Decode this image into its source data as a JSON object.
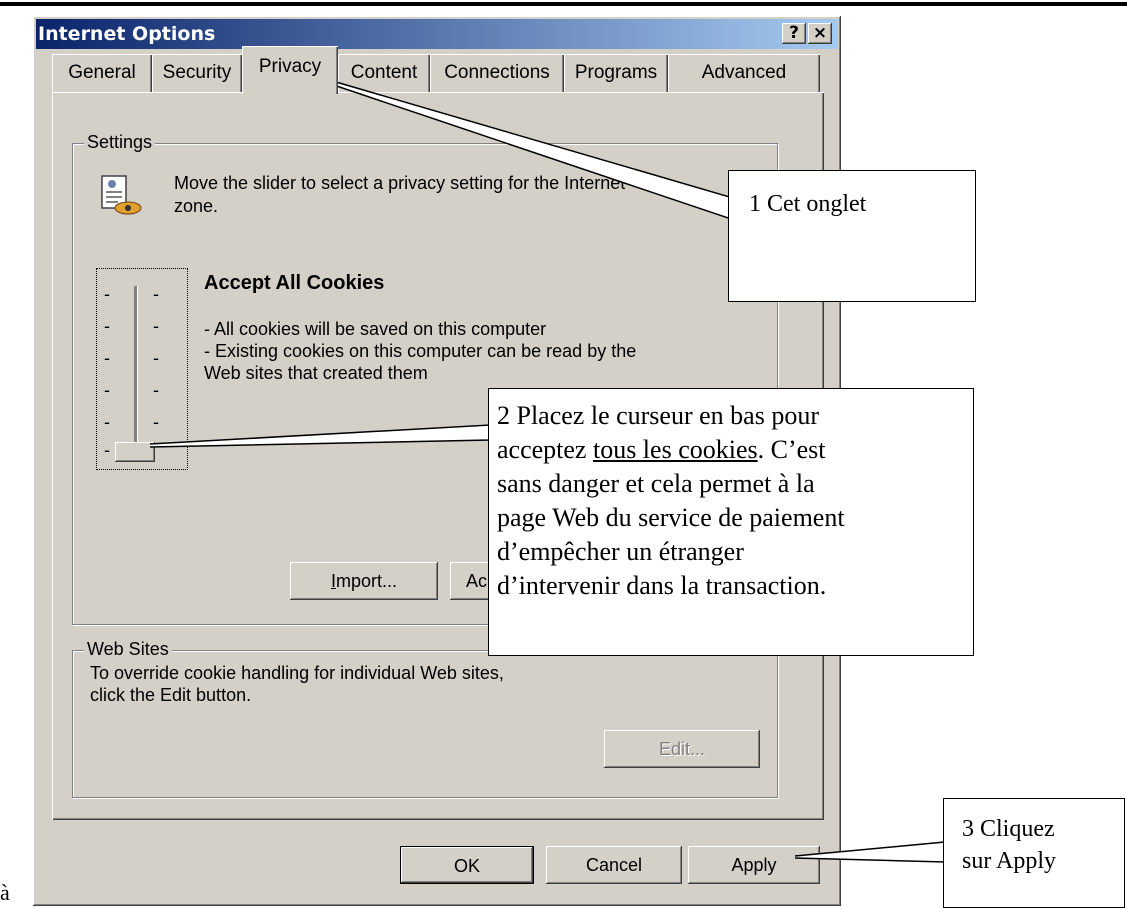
{
  "stray_char": "à",
  "window": {
    "title": "Internet Options",
    "help_label": "?",
    "close_label": "×"
  },
  "tabs": [
    {
      "label": "General"
    },
    {
      "label": "Security"
    },
    {
      "label": "Privacy",
      "active": true
    },
    {
      "label": "Content"
    },
    {
      "label": "Connections"
    },
    {
      "label": "Programs"
    },
    {
      "label": "Advanced"
    }
  ],
  "settings": {
    "legend": "Settings",
    "intro_line1": "Move the slider to select a privacy setting for the Internet",
    "intro_line2": "zone.",
    "level_title": "Accept All Cookies",
    "desc_line1": "- All cookies will be saved on this computer",
    "desc_line2": "- Existing cookies on this computer can be read by the",
    "desc_line3": "Web sites that created them",
    "slider_ticks": [
      "-",
      "-",
      "-",
      "-",
      "-",
      "-"
    ],
    "slider_level": "lowest",
    "import_label": "Import...",
    "advanced_label": "Ac"
  },
  "web_sites": {
    "legend": "Web Sites",
    "line1": "To override cookie handling for individual Web sites,",
    "line2": "click the Edit button.",
    "edit_label": "Edit..."
  },
  "buttons": {
    "ok": "OK",
    "cancel": "Cancel",
    "apply": "Apply"
  },
  "callouts": {
    "c1": "1 Cet onglet",
    "c2_a": "2 Placez le curseur en bas pour",
    "c2_b": "acceptez ",
    "c2_b_u": "tous les cookies",
    "c2_b_end": ".  C’est",
    "c2_c": "sans danger et cela permet à la",
    "c2_d": "page Web du service de paiement",
    "c2_e": "d’empêcher un étranger",
    "c2_f": "d’intervenir dans la transaction.",
    "c3_a": "3 Cliquez",
    "c3_b": "sur Apply"
  }
}
